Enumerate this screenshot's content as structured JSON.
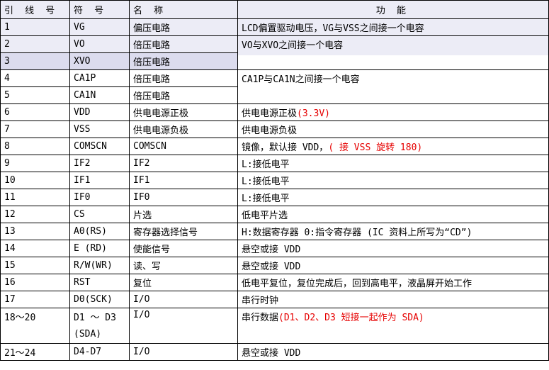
{
  "headers": {
    "pin": "引 线 号",
    "symbol": "符 号",
    "name": "名 称",
    "function": "功 能"
  },
  "colors": {
    "accent_red": "#e60000",
    "watermark": "#c8c8e4",
    "highlight_row": "#dcdcee"
  },
  "rows": [
    {
      "pin": "1",
      "symbol": "VG",
      "name": "偏压电路"
    },
    {
      "pin": "2",
      "symbol": "VO",
      "name": "倍压电路"
    },
    {
      "pin": "3",
      "symbol": "XVO",
      "name": "倍压电路"
    },
    {
      "pin": "4",
      "symbol": "CA1P",
      "name": "倍压电路"
    },
    {
      "pin": "5",
      "symbol": "CA1N",
      "name": "倍压电路"
    },
    {
      "pin": "6",
      "symbol": "VDD",
      "name": "供电电源正极"
    },
    {
      "pin": "7",
      "symbol": "VSS",
      "name": "供电电源负极"
    },
    {
      "pin": "8",
      "symbol": "COMSCN",
      "name": "COMSCN"
    },
    {
      "pin": "9",
      "symbol": "IF2",
      "name": "IF2"
    },
    {
      "pin": "10",
      "symbol": "IF1",
      "name": "IF1"
    },
    {
      "pin": "11",
      "symbol": "IF0",
      "name": "IF0"
    },
    {
      "pin": "12",
      "symbol": "CS",
      "name": "片选"
    },
    {
      "pin": "13",
      "symbol": "A0(RS)",
      "name": "寄存器选择信号"
    },
    {
      "pin": "14",
      "symbol": "E (RD)",
      "name": "使能信号"
    },
    {
      "pin": "15",
      "symbol": "R/W(WR)",
      "name": "读、写"
    },
    {
      "pin": "16",
      "symbol": "RST",
      "name": "复位"
    },
    {
      "pin": "17",
      "symbol": "D0(SCK)",
      "name": "I/O"
    },
    {
      "pin": "18～20",
      "symbol_line1": "D1 ～ D3",
      "symbol_line2": "(SDA)",
      "name": "I/O"
    },
    {
      "pin": "21～24",
      "symbol": "D4-D7",
      "name": "I/O"
    }
  ],
  "functions": {
    "r1": "LCD偏置驱动电压，VG与VSS之间接一个电容",
    "r2": "VO与XVO之间接一个电容",
    "r4": "CA1P与CA1N之间接一个电容",
    "r6_main": "供电电源正极",
    "r6_red": "(3.3V)",
    "r7": "供电电源负极",
    "r8_main": "镜像，默认接 VDD，",
    "r8_red": "( 接 VSS 旋转 180)",
    "r9": "L:接低电平",
    "r10": "L:接低电平",
    "r11": "L:接低电平",
    "r12": "低电平片选",
    "r13": "H:数据寄存器 0:指令寄存器 (IC 资料上所写为“CD”)",
    "r14": "悬空或接 VDD",
    "r15": "悬空或接 VDD",
    "r16": "低电平复位，复位完成后，回到高电平，液晶屏开始工作",
    "r17": "串行时钟",
    "r18_main": "串行数据",
    "r18_red": "(D1、D2、D3 短接一起作为 SDA)",
    "r21": "悬空或接 VDD"
  }
}
